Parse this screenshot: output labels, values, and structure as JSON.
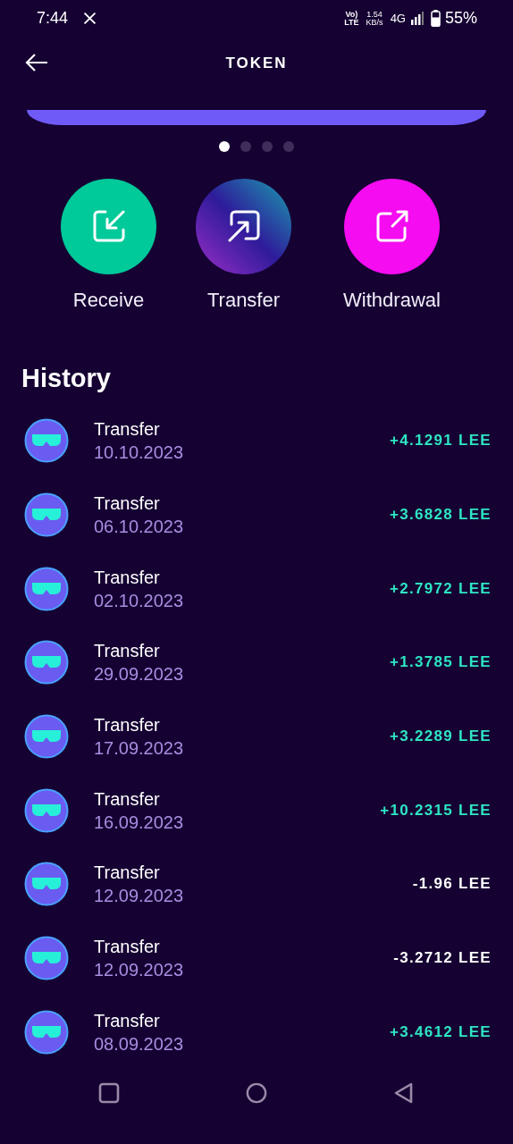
{
  "status_bar": {
    "time": "7:44",
    "volte": [
      "Vo)",
      "LTE"
    ],
    "speed": [
      "1.54",
      "KB/s"
    ],
    "network": "4G",
    "battery": "55%"
  },
  "header": {
    "title": "TOKEN"
  },
  "pager": [
    {
      "selected": true
    },
    {
      "selected": false
    },
    {
      "selected": false
    },
    {
      "selected": false
    }
  ],
  "actions": [
    {
      "kind": "receive",
      "label": "Receive"
    },
    {
      "kind": "transfer",
      "label": "Transfer"
    },
    {
      "kind": "withdrawal",
      "label": "Withdrawal"
    }
  ],
  "history": {
    "title": "History",
    "items": [
      {
        "title": "Transfer",
        "date": "10.10.2023",
        "amount": "+4.1291 LEE",
        "kind": "credit"
      },
      {
        "title": "Transfer",
        "date": "06.10.2023",
        "amount": "+3.6828 LEE",
        "kind": "credit"
      },
      {
        "title": "Transfer",
        "date": "02.10.2023",
        "amount": "+2.7972 LEE",
        "kind": "credit"
      },
      {
        "title": "Transfer",
        "date": "29.09.2023",
        "amount": "+1.3785 LEE",
        "kind": "credit"
      },
      {
        "title": "Transfer",
        "date": "17.09.2023",
        "amount": "+3.2289 LEE",
        "kind": "credit"
      },
      {
        "title": "Transfer",
        "date": "16.09.2023",
        "amount": "+10.2315 LEE",
        "kind": "credit"
      },
      {
        "title": "Transfer",
        "date": "12.09.2023",
        "amount": "-1.96 LEE",
        "kind": "debit"
      },
      {
        "title": "Transfer",
        "date": "12.09.2023",
        "amount": "-3.2712 LEE",
        "kind": "debit"
      },
      {
        "title": "Transfer",
        "date": "08.09.2023",
        "amount": "+3.4612 LEE",
        "kind": "credit"
      }
    ]
  }
}
